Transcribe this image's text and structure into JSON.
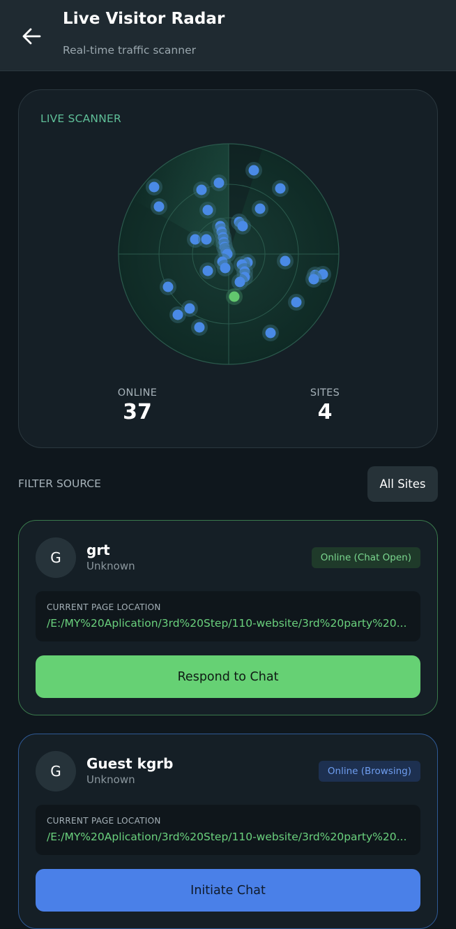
{
  "header": {
    "title": "Live Visitor Radar",
    "subtitle": "Real-time traffic scanner",
    "back_icon": "arrow-left-icon"
  },
  "scanner": {
    "label": "LIVE SCANNER",
    "stats": {
      "online_label": "ONLINE",
      "online_value": "37",
      "sites_label": "SITES",
      "sites_value": "4"
    },
    "colors": {
      "dot": "#4a8ae6",
      "dot_active": "#62c86e",
      "accent": "#5fbf98"
    }
  },
  "filter": {
    "label": "FILTER SOURCE",
    "selected": "All Sites"
  },
  "visitors": [
    {
      "initial": "G",
      "name": "grt",
      "location_type": "Unknown",
      "status": "Online (Chat Open)",
      "page_label": "CURRENT PAGE LOCATION",
      "page_url": "/E:/MY%20Aplication/3rd%20Step/110-website/3rd%20party%20...",
      "action": "Respond to Chat"
    },
    {
      "initial": "G",
      "name": "Guest kgrb",
      "location_type": "Unknown",
      "status": "Online (Browsing)",
      "page_label": "CURRENT PAGE LOCATION",
      "page_url": "/E:/MY%20Aplication/3rd%20Step/110-website/3rd%20party%20...",
      "action": "Initiate Chat"
    }
  ]
}
